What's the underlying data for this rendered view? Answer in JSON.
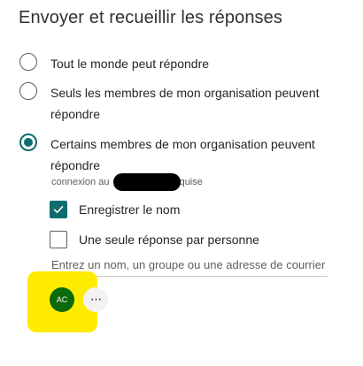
{
  "page": {
    "title": "Envoyer et recueillir les réponses"
  },
  "options": [
    {
      "label": "Tout le monde peut répondre",
      "selected": false
    },
    {
      "label": "Seuls les membres de mon organisation peuvent répondre",
      "selected": false
    },
    {
      "label": "Certains membres de mon organisation peuvent répondre",
      "selected": true
    }
  ],
  "note": {
    "prefix": "connexion au",
    "suffix": "equise"
  },
  "checkboxes": {
    "record_name": {
      "label": "Enregistrer le nom",
      "checked": true
    },
    "one_response": {
      "label": "Une seule réponse par personne",
      "checked": false
    }
  },
  "people_picker": {
    "placeholder": "Entrez un nom, un groupe ou une adresse de courrier",
    "value": ""
  },
  "selected_people": [
    {
      "initials": "AC",
      "color": "#0b6a0b"
    }
  ],
  "more_button": {
    "icon": "more-horizontal-icon",
    "label": "···"
  },
  "colors": {
    "accent": "#0f6c6e",
    "highlight": "#ffeb00"
  }
}
